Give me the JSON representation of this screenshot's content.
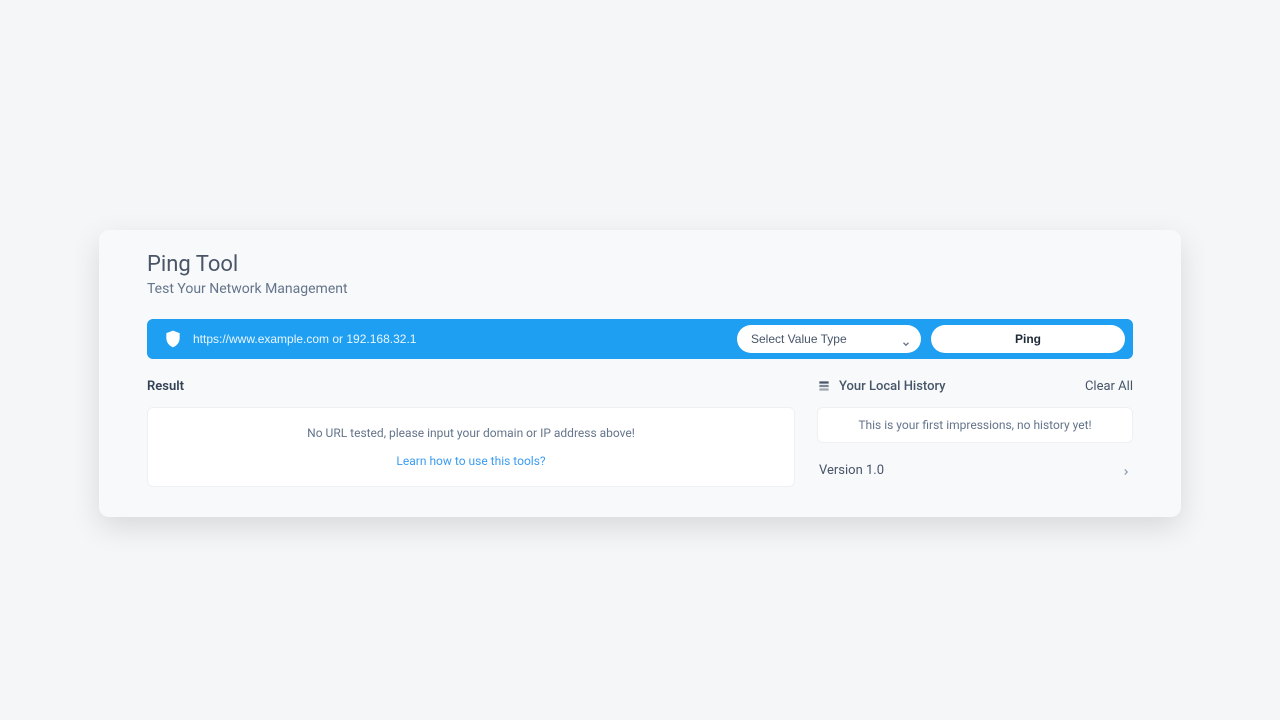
{
  "header": {
    "title": "Ping Tool",
    "subtitle": "Test Your Network Management"
  },
  "search": {
    "placeholder": "https://www.example.com or 192.168.32.1",
    "select_placeholder": "Select Value Type",
    "ping_label": "Ping"
  },
  "result": {
    "heading": "Result",
    "empty_text": "No URL tested, please input your domain or IP address above!",
    "learn_link": "Learn how to use this tools?"
  },
  "history": {
    "heading": "Your Local History",
    "clear_label": "Clear All",
    "empty_text": "This is your first impressions, no history yet!"
  },
  "version": {
    "label": "Version 1.0"
  }
}
